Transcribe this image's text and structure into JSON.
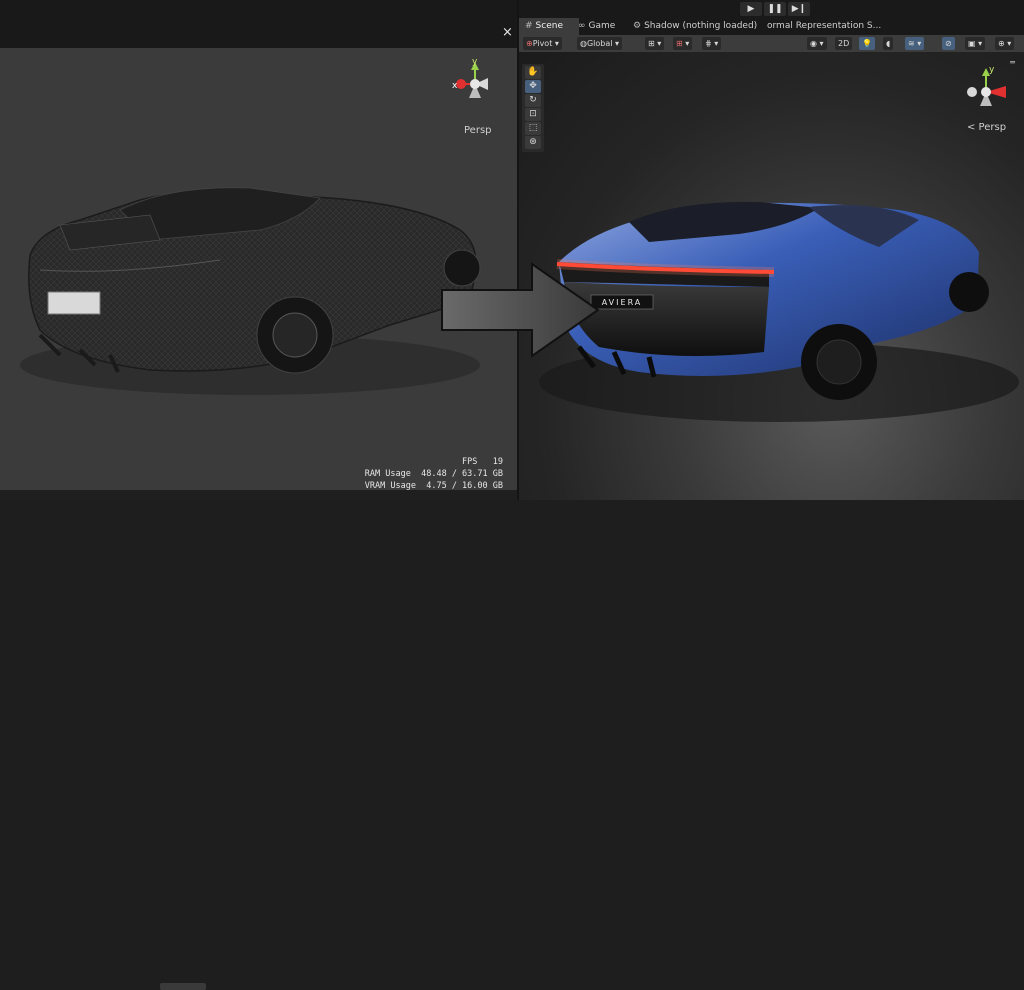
{
  "left_view": {
    "close_symbol": "×",
    "gizmo": {
      "x_label": "x",
      "y_label": "y",
      "projection": "Persp"
    },
    "stats": {
      "fps_label": "FPS",
      "fps_value": "19",
      "ram_label": "RAM Usage",
      "ram_value": "48.48 / 63.71 GB",
      "vram_label": "VRAM Usage",
      "vram_value": "4.75 / 16.00 GB"
    },
    "car_badge": ""
  },
  "play_controls": {
    "play": "▶",
    "pause": "❚❚",
    "step": "▶❙"
  },
  "tabs": [
    {
      "icon": "#",
      "label": "Scene"
    },
    {
      "icon": "∞",
      "label": "Game"
    },
    {
      "icon": "⚙",
      "label": "Shadow (nothing loaded)"
    },
    {
      "icon": "",
      "label": "ormal Representation S..."
    }
  ],
  "toolbar": {
    "pivot": "Pivot",
    "global": "Global",
    "mode_2d": "2D"
  },
  "right_view": {
    "gizmo": {
      "y_label": "y",
      "projection": "< Persp"
    },
    "car_badge": "AVIERA"
  },
  "colors": {
    "car_blue": "#3a5fb8",
    "taillight_red": "#ff3a2a",
    "selection_blue": "#46607d"
  }
}
